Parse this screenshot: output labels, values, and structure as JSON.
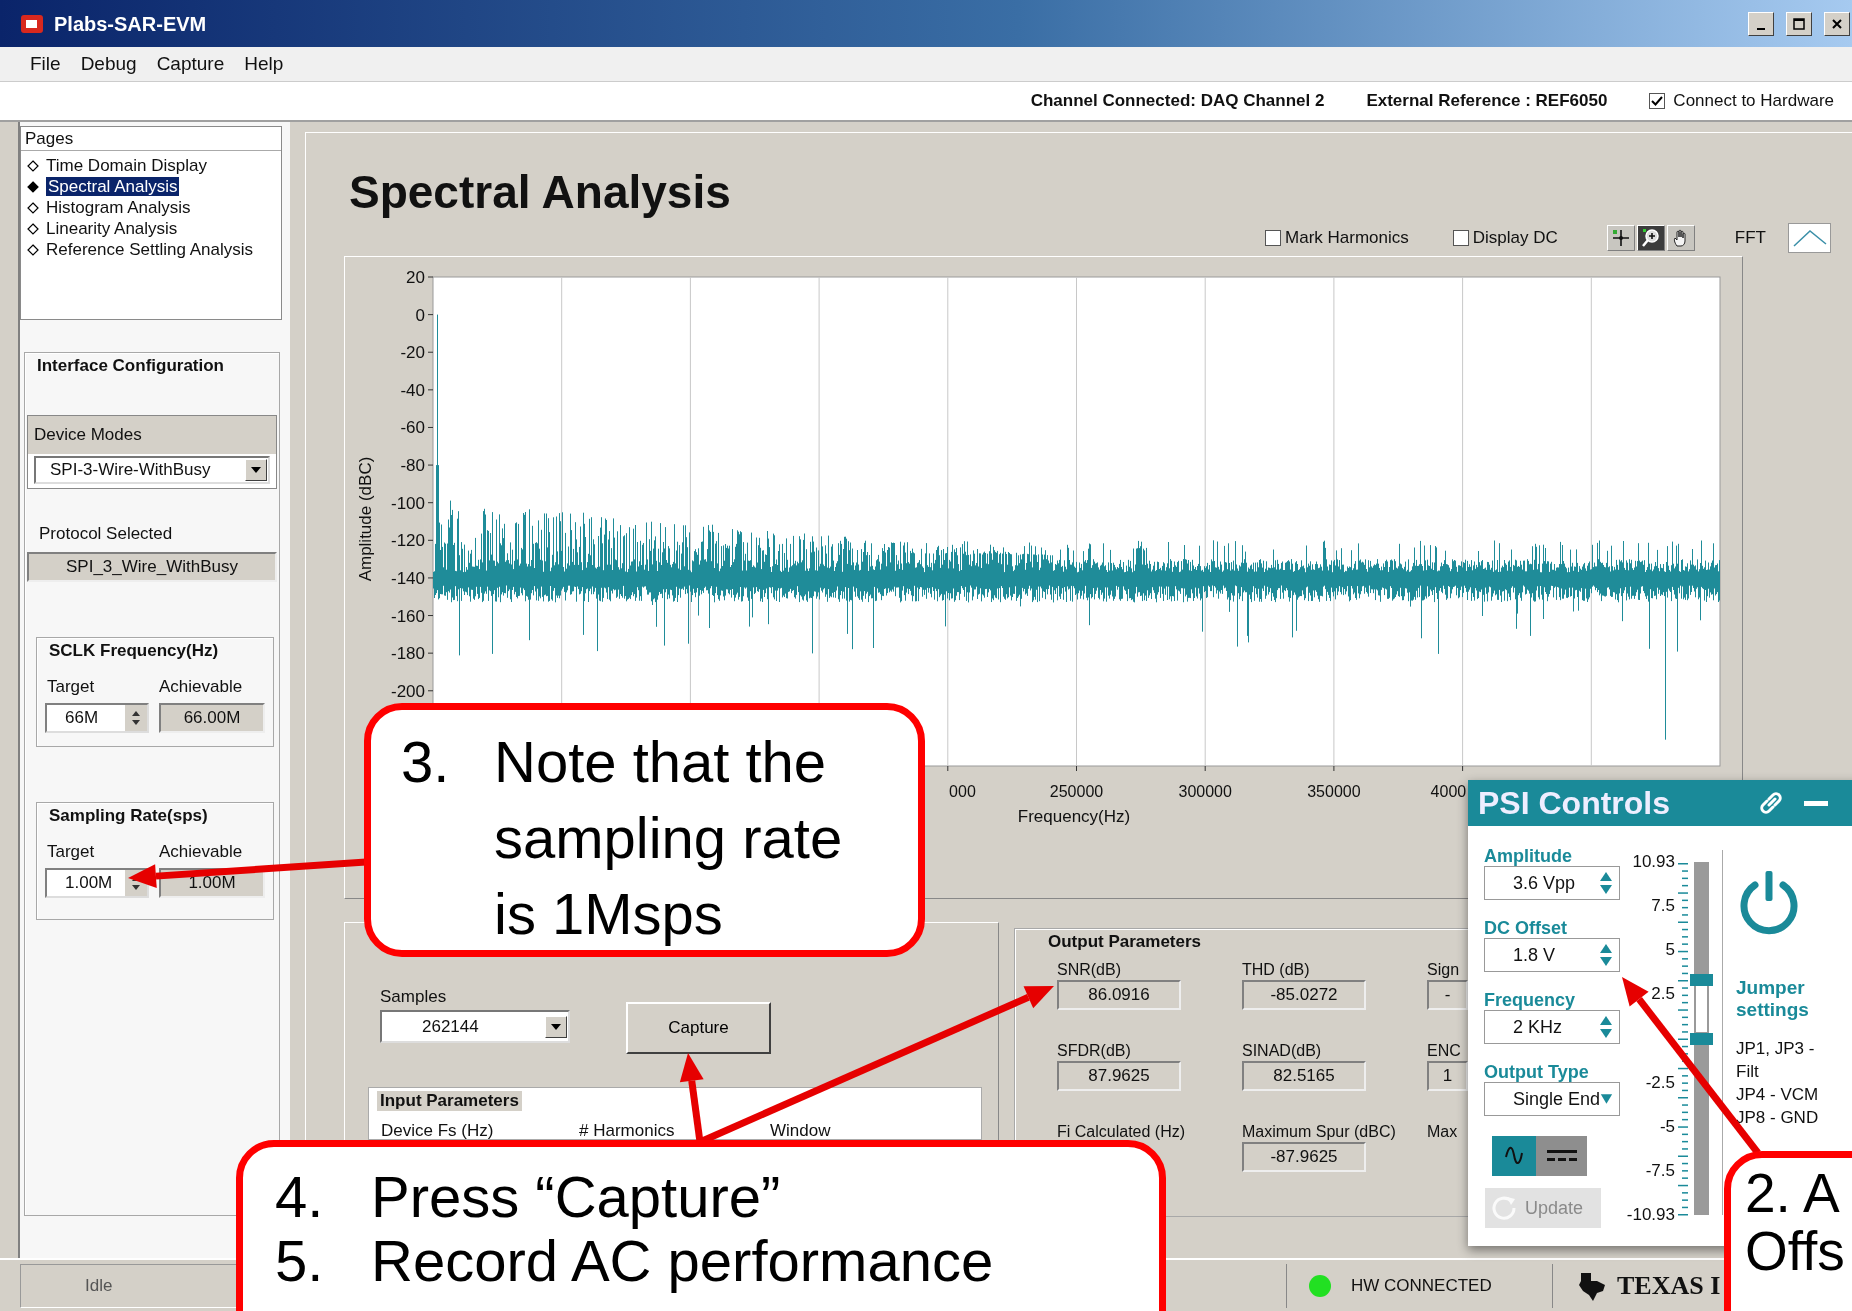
{
  "window": {
    "title": "Plabs-SAR-EVM"
  },
  "menu": [
    "File",
    "Debug",
    "Capture",
    "Help"
  ],
  "info_bar": {
    "channel": "Channel Connected: DAQ Channel 2",
    "reference": "External Reference : REF6050",
    "connect": {
      "label": "Connect to Hardware",
      "checked": true
    }
  },
  "pages": {
    "title": "Pages",
    "items": [
      {
        "label": "Time Domain Display",
        "selected": false
      },
      {
        "label": "Spectral Analysis",
        "selected": true
      },
      {
        "label": "Histogram Analysis",
        "selected": false
      },
      {
        "label": "Linearity Analysis",
        "selected": false
      },
      {
        "label": "Reference Settling Analysis",
        "selected": false
      }
    ]
  },
  "interface_config": {
    "title": "Interface Configuration",
    "device_modes": {
      "label": "Device Modes",
      "value": "SPI-3-Wire-WithBusy"
    },
    "protocol": {
      "label": "Protocol Selected",
      "value": "SPI_3_Wire_WithBusy"
    },
    "groups": [
      {
        "title": "SCLK Frequency(Hz)",
        "target_label": "Target",
        "target": "66M",
        "achievable_label": "Achievable",
        "achievable": "66.00M"
      },
      {
        "title": "Sampling Rate(sps)",
        "target_label": "Target",
        "target": "1.00M",
        "achievable_label": "Achievable",
        "achievable": "1.00M"
      }
    ]
  },
  "page_title": "Spectral Analysis",
  "chart_options": [
    {
      "label": "Mark Harmonics",
      "checked": false
    },
    {
      "label": "Display DC",
      "checked": false
    }
  ],
  "chart_tools": [
    {
      "kind": "cursor",
      "selected": false
    },
    {
      "kind": "zoom",
      "selected": true
    },
    {
      "kind": "pan",
      "selected": false
    }
  ],
  "fft_label": "FFT",
  "spectrum": {
    "xlabel": "Frequency(Hz)",
    "ylabel": "Amplitude (dBC)",
    "y_labels": [
      "20",
      "0",
      "-20",
      "-40",
      "-60",
      "-80",
      "-100",
      "-120",
      "-140",
      "-160",
      "-180",
      "-200"
    ],
    "x_labels": [
      "000",
      "250000",
      "300000",
      "350000",
      "4000"
    ]
  },
  "capture": {
    "samples_label": "Samples",
    "samples": "262144",
    "button": "Capture",
    "input_parameters": {
      "title": "Input Parameters",
      "columns": [
        "Device Fs (Hz)",
        "# Harmonics",
        "Window"
      ]
    }
  },
  "output_parameters": {
    "title": "Output Parameters",
    "items": [
      {
        "label": "SNR(dB)",
        "value": "86.0916"
      },
      {
        "label": "THD (dB)",
        "value": "-85.0272"
      },
      {
        "label": "Sign",
        "value": "-"
      },
      {
        "label": "SFDR(dB)",
        "value": "87.9625"
      },
      {
        "label": "SINAD(dB)",
        "value": "82.5165"
      },
      {
        "label": "ENC",
        "value": "1"
      },
      {
        "label": "Fi Calculated (Hz)"
      },
      {
        "label": "Maximum Spur (dBC)",
        "value": "-87.9625"
      },
      {
        "label": "Max"
      }
    ]
  },
  "status_bar": {
    "state": "Idle",
    "hw": {
      "label": "HW CONNECTED",
      "color": "#22e022"
    },
    "logo": "TEXAS I"
  },
  "psi_controls": {
    "title": "PSI Controls",
    "fields": [
      {
        "label": "Amplitude",
        "value": "3.6 Vpp",
        "kind": "spin"
      },
      {
        "label": "DC Offset",
        "value": "1.8 V",
        "kind": "spin"
      },
      {
        "label": "Frequency",
        "value": "2 KHz",
        "kind": "spin"
      },
      {
        "label": "Output Type",
        "value": "Single End",
        "kind": "dropdown"
      }
    ],
    "waveforms": [
      {
        "kind": "sine",
        "selected": true
      },
      {
        "kind": "dc",
        "selected": false
      }
    ],
    "update": {
      "label": "Update",
      "disabled": true
    },
    "scale": [
      "10.93",
      "7.5",
      "5",
      "2.5",
      "-2.5",
      "-5",
      "-7.5",
      "-10.93"
    ],
    "thumbs": [
      {
        "level": 0.665
      },
      {
        "level": 0.5
      }
    ],
    "jumper": {
      "title": "Jumper settings",
      "lines": [
        "JP1, JP3 - Filt",
        "JP4 - VCM",
        "JP8 - GND"
      ]
    }
  },
  "callouts": [
    {
      "kind": "numbered",
      "items": [
        {
          "number": "3.",
          "text": "Note that the sampling rate is 1Msps"
        }
      ]
    },
    {
      "kind": "numbered",
      "items": [
        {
          "number": "4.",
          "text": "Press “Capture”"
        },
        {
          "number": "5.",
          "text": "Record AC performance"
        }
      ]
    },
    {
      "kind": "plain",
      "lines": [
        "2. A",
        "Offs"
      ]
    }
  ]
}
